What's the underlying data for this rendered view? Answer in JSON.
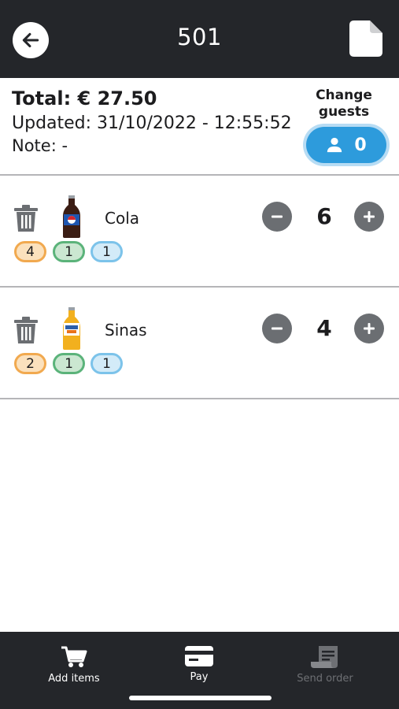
{
  "header": {
    "title": "501",
    "back_icon": "arrow-left-icon",
    "doc_icon": "document-icon"
  },
  "summary": {
    "total": "Total: € 27.50",
    "updated": "Updated: 31/10/2022 - 12:55:52",
    "note": "Note:  -",
    "change_guests_line1": "Change",
    "change_guests_line2": "guests",
    "guest_count": "0",
    "guest_button_color": "#2d9bdc"
  },
  "items": [
    {
      "name": "Cola",
      "quantity": "6",
      "badges": [
        {
          "value": "4",
          "color": "orange"
        },
        {
          "value": "1",
          "color": "green"
        },
        {
          "value": "1",
          "color": "blue"
        }
      ]
    },
    {
      "name": "Sinas",
      "quantity": "4",
      "badges": [
        {
          "value": "2",
          "color": "orange"
        },
        {
          "value": "1",
          "color": "green"
        },
        {
          "value": "1",
          "color": "blue"
        }
      ]
    }
  ],
  "tabs": [
    {
      "label": "Add items",
      "icon": "cart-icon",
      "enabled": true
    },
    {
      "label": "Pay",
      "icon": "credit-card-icon",
      "enabled": true
    },
    {
      "label": "Send order",
      "icon": "receipt-icon",
      "enabled": false
    }
  ],
  "colors": {
    "dark_bar": "#24262a",
    "badge_orange": "#f1a94f",
    "badge_green": "#5bb37a",
    "badge_blue": "#7cc3ea"
  }
}
